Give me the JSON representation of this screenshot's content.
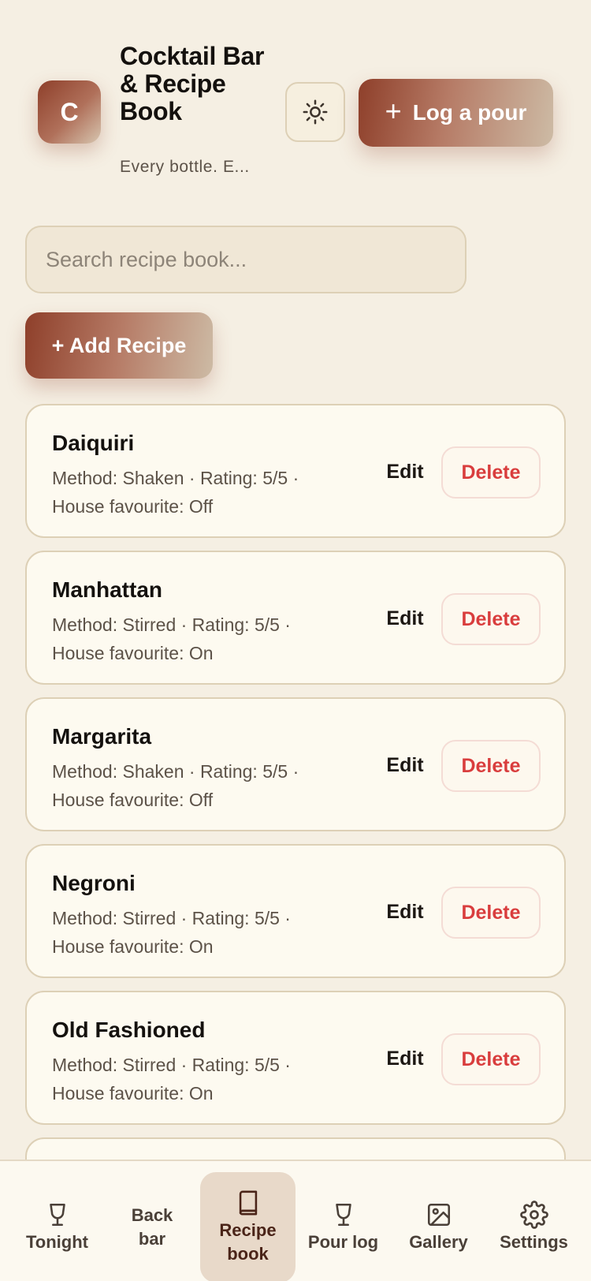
{
  "header": {
    "avatar_letter": "C",
    "title": "Cocktail Bar & Recipe Book",
    "subtitle": "Every bottle. E...",
    "theme_icon": "sun-icon",
    "log_button": {
      "icon": "plus-icon",
      "label": "Log a pour"
    }
  },
  "search": {
    "placeholder": "Search recipe book..."
  },
  "add_recipe_label": "+ Add Recipe",
  "recipes": [
    {
      "name": "Daiquiri",
      "meta": "Method: Shaken · Rating: 5/5 · House favourite: Off",
      "edit": "Edit",
      "delete": "Delete"
    },
    {
      "name": "Manhattan",
      "meta": "Method: Stirred · Rating: 5/5 · House favourite: On",
      "edit": "Edit",
      "delete": "Delete"
    },
    {
      "name": "Margarita",
      "meta": "Method: Shaken · Rating: 5/5 · House favourite: Off",
      "edit": "Edit",
      "delete": "Delete"
    },
    {
      "name": "Negroni",
      "meta": "Method: Stirred · Rating: 5/5 · House favourite: On",
      "edit": "Edit",
      "delete": "Delete"
    },
    {
      "name": "Old Fashioned",
      "meta": "Method: Stirred · Rating: 5/5 · House favourite: On",
      "edit": "Edit",
      "delete": "Delete"
    }
  ],
  "nav": {
    "items": [
      {
        "label": "Tonight",
        "icon": "glass-icon"
      },
      {
        "label": "Back bar",
        "icon": ""
      },
      {
        "label": "Recipe book",
        "icon": "book-icon",
        "active": true
      },
      {
        "label": "Pour log",
        "icon": "glass-icon"
      },
      {
        "label": "Gallery",
        "icon": "image-icon"
      },
      {
        "label": "Settings",
        "icon": "gear-icon"
      }
    ]
  },
  "colors": {
    "background": "#f5efe3",
    "accent": "#8e3f2a",
    "card": "#fdfaf0",
    "danger": "#d93d3d"
  }
}
